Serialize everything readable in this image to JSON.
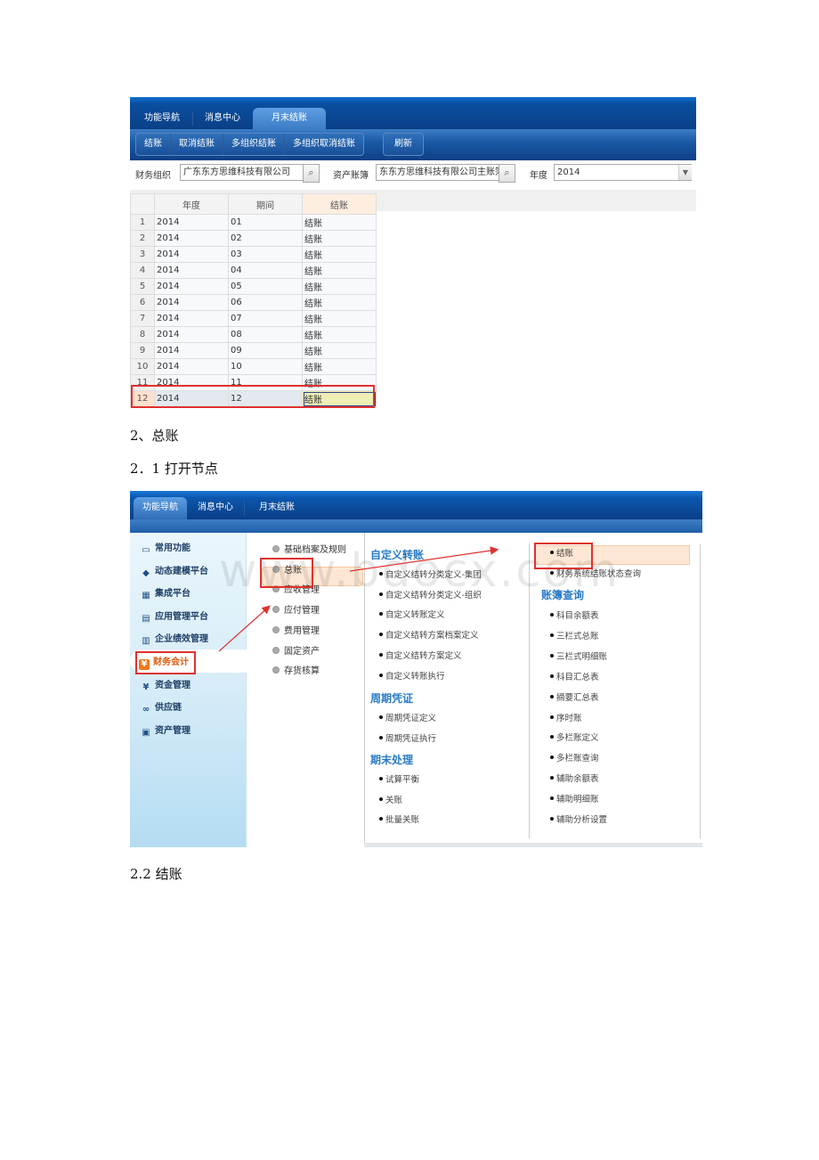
{
  "screenshot1": {
    "tabs": [
      {
        "label": "功能导航",
        "active": false
      },
      {
        "label": "消息中心",
        "active": false
      },
      {
        "label": "月末结账",
        "active": true
      }
    ],
    "toolbar": {
      "buttons": [
        "结账",
        "取消结账",
        "多组织结账",
        "多组织取消结账"
      ],
      "refresh": "刷新"
    },
    "filters": {
      "org_label": "财务组织",
      "org_value": "广东东方思维科技有限公司",
      "book_label": "资产账簿",
      "book_value": "东东方思维科技有限公司主账簿",
      "year_label": "年度",
      "year_value": "2014"
    },
    "grid": {
      "columns": [
        "年度",
        "期间",
        "结账"
      ],
      "rows": [
        {
          "no": "1",
          "year": "2014",
          "period": "01",
          "action": "结账"
        },
        {
          "no": "2",
          "year": "2014",
          "period": "02",
          "action": "结账"
        },
        {
          "no": "3",
          "year": "2014",
          "period": "03",
          "action": "结账"
        },
        {
          "no": "4",
          "year": "2014",
          "period": "04",
          "action": "结账"
        },
        {
          "no": "5",
          "year": "2014",
          "period": "05",
          "action": "结账"
        },
        {
          "no": "6",
          "year": "2014",
          "period": "06",
          "action": "结账"
        },
        {
          "no": "7",
          "year": "2014",
          "period": "07",
          "action": "结账"
        },
        {
          "no": "8",
          "year": "2014",
          "period": "08",
          "action": "结账"
        },
        {
          "no": "9",
          "year": "2014",
          "period": "09",
          "action": "结账"
        },
        {
          "no": "10",
          "year": "2014",
          "period": "10",
          "action": "结账"
        },
        {
          "no": "11",
          "year": "2014",
          "period": "11",
          "action": "结账"
        },
        {
          "no": "12",
          "year": "2014",
          "period": "12",
          "action": "结账"
        }
      ],
      "selected_row": "12"
    }
  },
  "headings": {
    "h1": "2、总账",
    "h2": "2．1 打开节点",
    "h3": "2.2 结账"
  },
  "screenshot2": {
    "tabs": [
      {
        "label": "功能导航",
        "active": true
      },
      {
        "label": "消息中心",
        "active": false
      },
      {
        "label": "月末结账",
        "active": false
      }
    ],
    "sidebar": [
      {
        "label": "常用功能",
        "icon": "monitor-icon"
      },
      {
        "label": "动态建模平台",
        "icon": "cube-icon"
      },
      {
        "label": "集成平台",
        "icon": "grid-plus-icon"
      },
      {
        "label": "应用管理平台",
        "icon": "app-window-icon"
      },
      {
        "label": "企业绩效管理",
        "icon": "table-icon"
      },
      {
        "label": "财务会计",
        "icon": "yen-badge-icon",
        "active": true
      },
      {
        "label": "资金管理",
        "icon": "yen-icon"
      },
      {
        "label": "供应链",
        "icon": "link-icon"
      },
      {
        "label": "资产管理",
        "icon": "asset-icon"
      }
    ],
    "modules": [
      "基础档案及规则",
      "总账",
      "应收管理",
      "应付管理",
      "费用管理",
      "固定资产",
      "存货核算"
    ],
    "active_module": "总账",
    "sections_col2": [
      {
        "title": "自定义转账",
        "items": [
          "自定义结转分类定义-集团",
          "自定义结转分类定义-组织",
          "自定义转账定义",
          "自定义结转方案档案定义",
          "自定义结转方案定义",
          "自定义转账执行"
        ]
      },
      {
        "title": "周期凭证",
        "items": [
          "周期凭证定义",
          "周期凭证执行"
        ]
      },
      {
        "title": "期末处理",
        "items": [
          "试算平衡",
          "关账",
          "批量关账"
        ]
      }
    ],
    "col3_top_items": [
      "结账",
      "财务系统结账状态查询"
    ],
    "sections_col3": [
      {
        "title": "账簿查询",
        "items": [
          "科目余额表",
          "三栏式总账",
          "三栏式明细账",
          "科目汇总表",
          "摘要汇总表",
          "序时账",
          "多栏账定义",
          "多栏账查询",
          "辅助余额表",
          "辅助明细账",
          "辅助分析设置"
        ]
      }
    ],
    "watermark": "www.bdocx.com"
  }
}
